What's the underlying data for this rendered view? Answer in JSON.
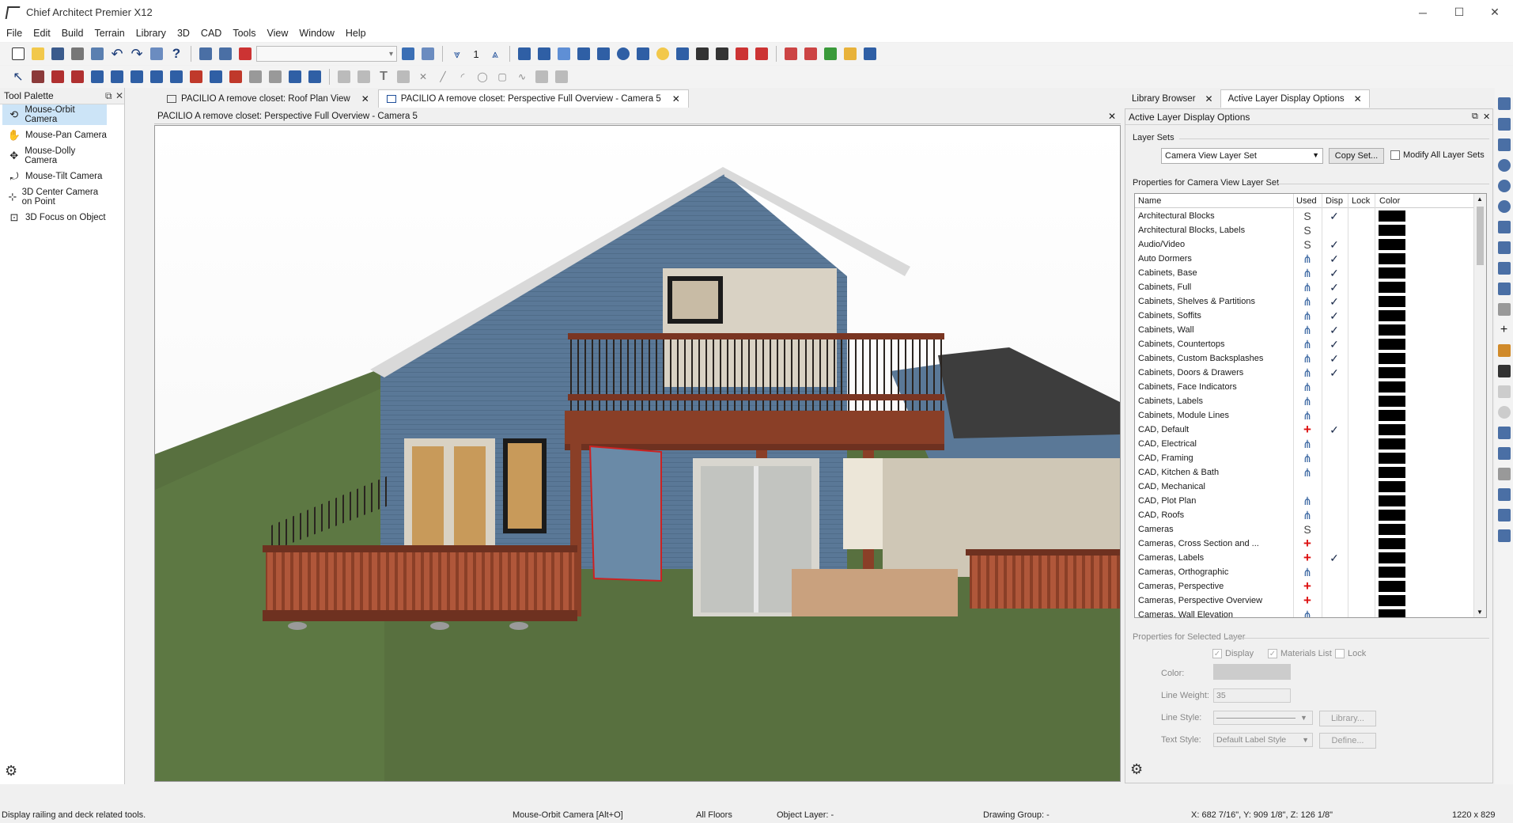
{
  "window": {
    "title": "Chief Architect Premier X12",
    "minimize": "─",
    "maximize": "☐",
    "close": "✕"
  },
  "menu": [
    "File",
    "Edit",
    "Build",
    "Terrain",
    "Library",
    "3D",
    "CAD",
    "Tools",
    "View",
    "Window",
    "Help"
  ],
  "toolbar": {
    "number_field": "1"
  },
  "tool_palette": {
    "title": "Tool Palette",
    "items": [
      {
        "label": "Mouse-Orbit Camera",
        "icon": "orbit-camera-icon"
      },
      {
        "label": "Mouse-Pan Camera",
        "icon": "pan-camera-icon"
      },
      {
        "label": "Mouse-Dolly Camera",
        "icon": "dolly-camera-icon"
      },
      {
        "label": "Mouse-Tilt Camera",
        "icon": "tilt-camera-icon"
      },
      {
        "label": "3D Center Camera on Point",
        "icon": "center-camera-icon"
      },
      {
        "label": "3D Focus on Object",
        "icon": "focus-object-icon"
      }
    ],
    "selected_index": 0
  },
  "tabs": [
    {
      "label": "PACILIO A remove closet: Roof Plan View",
      "active": false
    },
    {
      "label": "PACILIO A remove closet: Perspective Full Overview - Camera 5",
      "active": true
    }
  ],
  "view_title": "PACILIO A remove closet: Perspective Full Overview - Camera 5",
  "right_tabs": [
    {
      "label": "Library Browser",
      "active": false
    },
    {
      "label": "Active Layer Display Options",
      "active": true
    }
  ],
  "layer_panel": {
    "title": "Active Layer Display Options",
    "layer_sets_label": "Layer Sets",
    "layer_set_value": "Camera View Layer Set",
    "copy_set_button": "Copy Set...",
    "modify_all_label": "Modify All Layer Sets",
    "properties_label": "Properties for Camera View Layer Set",
    "columns": {
      "name": "Name",
      "used": "Used",
      "disp": "Disp",
      "lock": "Lock",
      "color": "Color"
    },
    "layers": [
      {
        "name": "Architectural Blocks",
        "used": "S",
        "disp": "✓",
        "color": "#000000"
      },
      {
        "name": "Architectural Blocks, Labels",
        "used": "S",
        "disp": "",
        "color": "#000000"
      },
      {
        "name": "Audio/Video",
        "used": "S",
        "disp": "✓",
        "color": "#000000"
      },
      {
        "name": "Auto Dormers",
        "used": "used",
        "disp": "✓",
        "color": "#000000"
      },
      {
        "name": "Cabinets,  Base",
        "used": "used",
        "disp": "✓",
        "color": "#000000"
      },
      {
        "name": "Cabinets,  Full",
        "used": "used",
        "disp": "✓",
        "color": "#000000"
      },
      {
        "name": "Cabinets,  Shelves & Partitions",
        "used": "used",
        "disp": "✓",
        "color": "#000000"
      },
      {
        "name": "Cabinets,  Soffits",
        "used": "used",
        "disp": "✓",
        "color": "#000000"
      },
      {
        "name": "Cabinets,  Wall",
        "used": "used",
        "disp": "✓",
        "color": "#000000"
      },
      {
        "name": "Cabinets, Countertops",
        "used": "used",
        "disp": "✓",
        "color": "#000000"
      },
      {
        "name": "Cabinets, Custom Backsplashes",
        "used": "used",
        "disp": "✓",
        "color": "#000000"
      },
      {
        "name": "Cabinets, Doors & Drawers",
        "used": "used",
        "disp": "✓",
        "color": "#000000"
      },
      {
        "name": "Cabinets, Face Indicators",
        "used": "used",
        "disp": "",
        "color": "#000000"
      },
      {
        "name": "Cabinets, Labels",
        "used": "used",
        "disp": "",
        "color": "#000000"
      },
      {
        "name": "Cabinets, Module Lines",
        "used": "used",
        "disp": "",
        "color": "#000000"
      },
      {
        "name": "CAD,  Default",
        "used": "+",
        "disp": "✓",
        "color": "#000000"
      },
      {
        "name": "CAD, Electrical",
        "used": "used",
        "disp": "",
        "color": "#000000"
      },
      {
        "name": "CAD, Framing",
        "used": "used",
        "disp": "",
        "color": "#000000"
      },
      {
        "name": "CAD, Kitchen & Bath",
        "used": "used",
        "disp": "",
        "color": "#000000"
      },
      {
        "name": "CAD, Mechanical",
        "used": "",
        "disp": "",
        "color": "#000000"
      },
      {
        "name": "CAD, Plot Plan",
        "used": "used",
        "disp": "",
        "color": "#000000"
      },
      {
        "name": "CAD, Roofs",
        "used": "used",
        "disp": "",
        "color": "#000000"
      },
      {
        "name": "Cameras",
        "used": "S",
        "disp": "",
        "color": "#000000"
      },
      {
        "name": "Cameras, Cross Section and ...",
        "used": "+",
        "disp": "",
        "color": "#000000"
      },
      {
        "name": "Cameras, Labels",
        "used": "+",
        "disp": "✓",
        "color": "#000000"
      },
      {
        "name": "Cameras, Orthographic",
        "used": "used",
        "disp": "",
        "color": "#000000"
      },
      {
        "name": "Cameras, Perspective",
        "used": "+",
        "disp": "",
        "color": "#000000"
      },
      {
        "name": "Cameras, Perspective Overview",
        "used": "+",
        "disp": "",
        "color": "#000000"
      },
      {
        "name": "Cameras, Wall Elevation",
        "used": "used",
        "disp": "",
        "color": "#000000"
      }
    ],
    "selected_props_label": "Properties for Selected Layer",
    "display_label": "Display",
    "materials_list_label": "Materials List",
    "lock_label": "Lock",
    "color_label": "Color:",
    "line_weight_label": "Line Weight:",
    "line_weight_value": "35",
    "line_style_label": "Line Style:",
    "library_button": "Library...",
    "text_style_label": "Text Style:",
    "text_style_value": "Default Label Style",
    "define_button": "Define..."
  },
  "status": {
    "hint": "Display railing and deck related tools.",
    "mode": "Mouse-Orbit Camera [Alt+O]",
    "floors": "All Floors",
    "object_layer": "Object Layer: -",
    "drawing_group": "Drawing Group: -",
    "coords": "X: 682 7/16\", Y: 909 1/8\", Z: 126 1/8\"",
    "size": "1220 x 829"
  }
}
